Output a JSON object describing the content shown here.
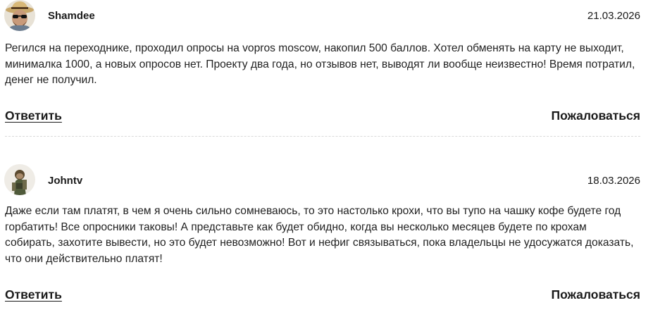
{
  "comments": [
    {
      "author": "Shamdee",
      "date": "21.03.2026",
      "avatar_icon": "user-avatar-icon",
      "text": "Регился на переходнике, проходил опросы на vopros moscow, накопил 500 баллов. Хотел обменять на карту не выходит, минималка 1000, а новых опросов нет. Проекту два года, но отзывов нет, выводят ли вообще неизвестно! Время потратил, денег не получил.",
      "reply_label": "Ответить",
      "report_label": "Пожаловаться"
    },
    {
      "author": "Johntv",
      "date": "18.03.2026",
      "avatar_icon": "user-avatar-icon",
      "text": "Даже если там платят, в чем я очень сильно сомневаюсь, то это настолько крохи, что вы тупо на чашку кофе будете год горбатить! Все опросники таковы! А представьте как будет обидно, когда вы несколько месяцев будете по крохам собирать, захотите вывести, но это будет невозможно! Вот и нефиг связываться, пока владельцы не удосужатся доказать, что они действительно платят!",
      "reply_label": "Ответить",
      "report_label": "Пожаловаться"
    }
  ]
}
